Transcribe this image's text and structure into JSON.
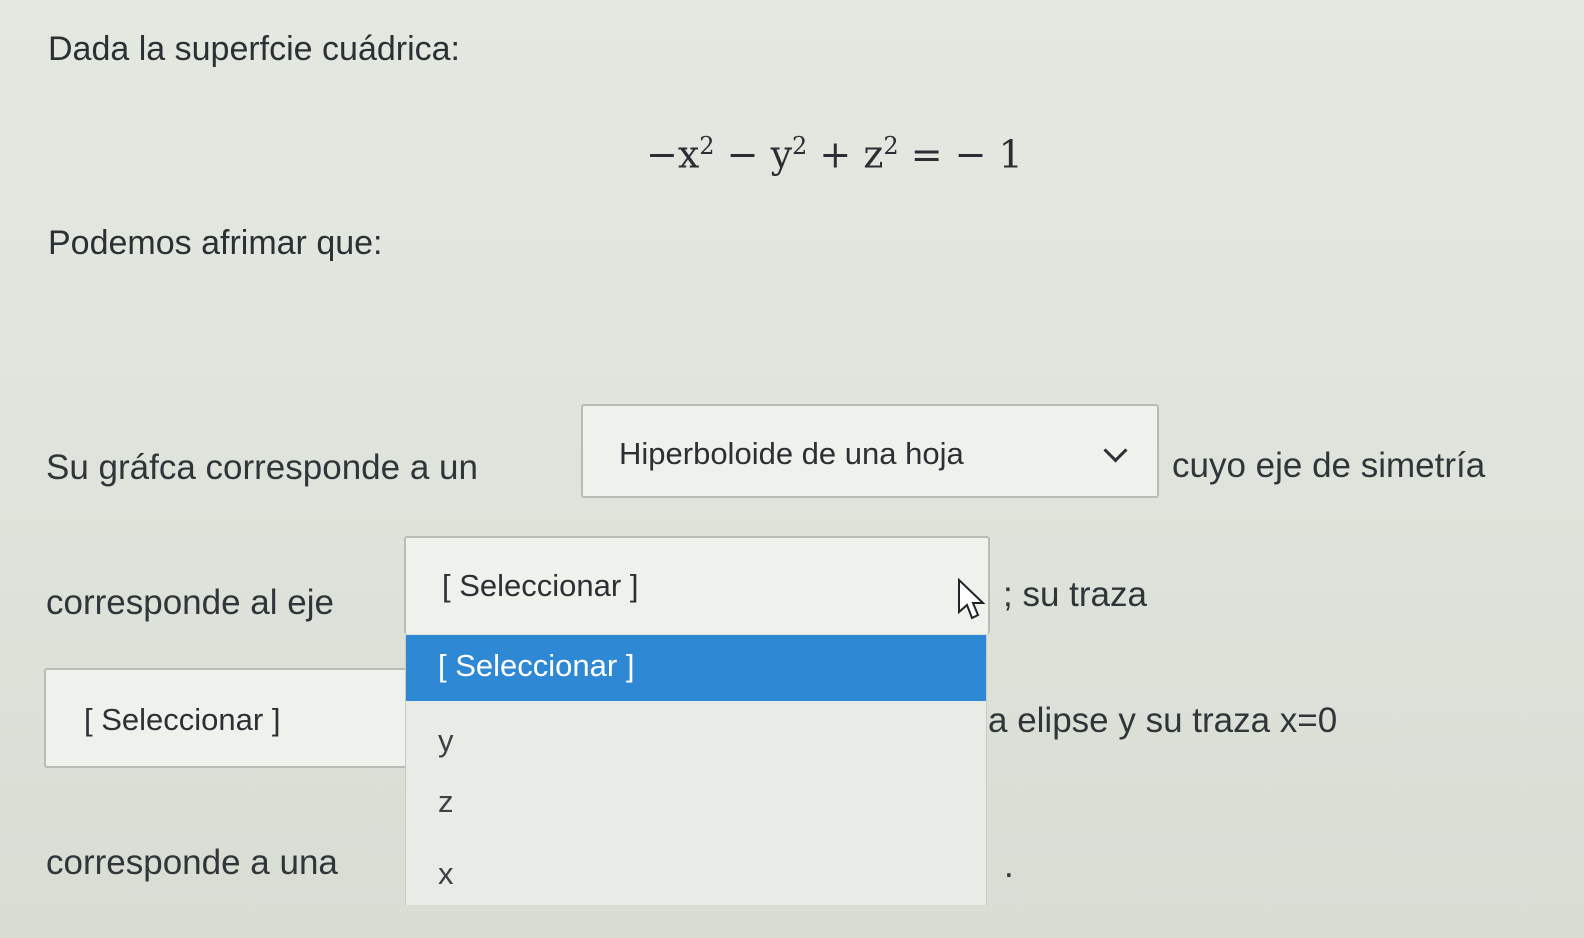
{
  "question": {
    "intro": "Dada la superfcie cuádrica:",
    "equation": {
      "x_sign": "−x",
      "y_sign": "− y",
      "z_sign": "+ z",
      "exponent": "2",
      "rhs": "= − 1"
    },
    "claim": "Podemos afrimar que:",
    "sentence_1_before": "Su gráfca corresponde a un",
    "sentence_1_after": "cuyo eje de simetría",
    "sentence_2_before": "corresponde al eje",
    "sentence_2_after": "; su traza",
    "sentence_3_after": "a elipse y su traza x=0",
    "sentence_4_before": "corresponde a una",
    "sentence_4_after": "."
  },
  "selects": {
    "surface_type": {
      "value": "Hiperboloide de una hoja",
      "icon": "chevron-down-icon"
    },
    "symmetry_axis": {
      "value": "[ Seleccionar ]"
    },
    "trace_type": {
      "value": "[ Seleccionar ]"
    }
  },
  "dropdown": {
    "options": [
      "[ Seleccionar ]",
      "y",
      "z",
      "x"
    ],
    "highlighted_index": 0,
    "highlight_color": "#2f88d3"
  },
  "cursor": {
    "icon": "mouse-pointer-icon"
  }
}
